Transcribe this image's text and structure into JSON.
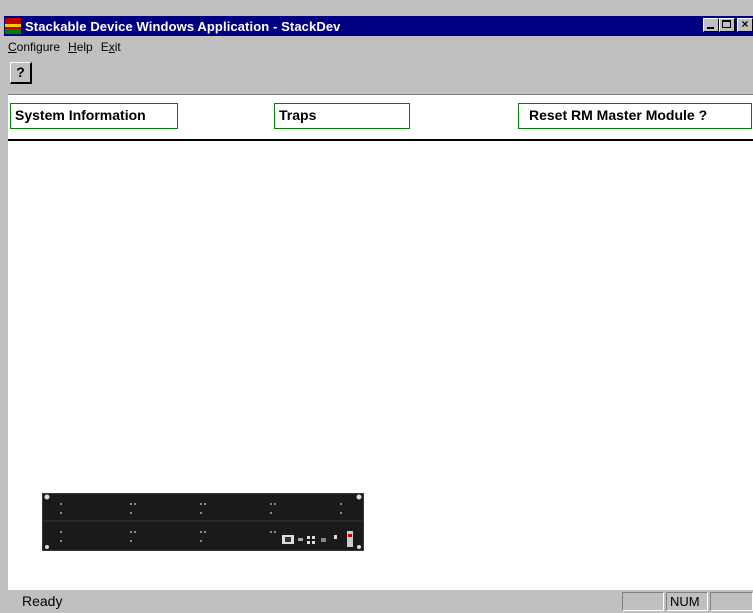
{
  "window": {
    "title": "Stackable Device Windows Application - StackDev",
    "app_icon": "milan-app-icon",
    "controls": {
      "minimize": "minimize-icon",
      "maximize": "maximize-icon",
      "close": "×"
    }
  },
  "menubar": {
    "items": [
      {
        "label_pre": "",
        "label_u": "C",
        "label_post": "onfigure"
      },
      {
        "label_pre": "",
        "label_u": "H",
        "label_post": "elp"
      },
      {
        "label_pre": "E",
        "label_u": "x",
        "label_post": "it"
      }
    ]
  },
  "toolbar": {
    "help_glyph": "?",
    "help_icon": "help-icon"
  },
  "panel": {
    "buttons": [
      {
        "label": "System Information"
      },
      {
        "label": "Traps"
      },
      {
        "label": "Reset RM Master Module ?"
      }
    ]
  },
  "device": {
    "icon": "stackable-chassis-image"
  },
  "colors": {
    "titlebar": "#000080",
    "face": "#c0c0c0",
    "button_border": "#008000",
    "client": "#ffffff"
  },
  "statusbar": {
    "text": "Ready",
    "indicators": [
      "",
      "NUM",
      ""
    ]
  }
}
